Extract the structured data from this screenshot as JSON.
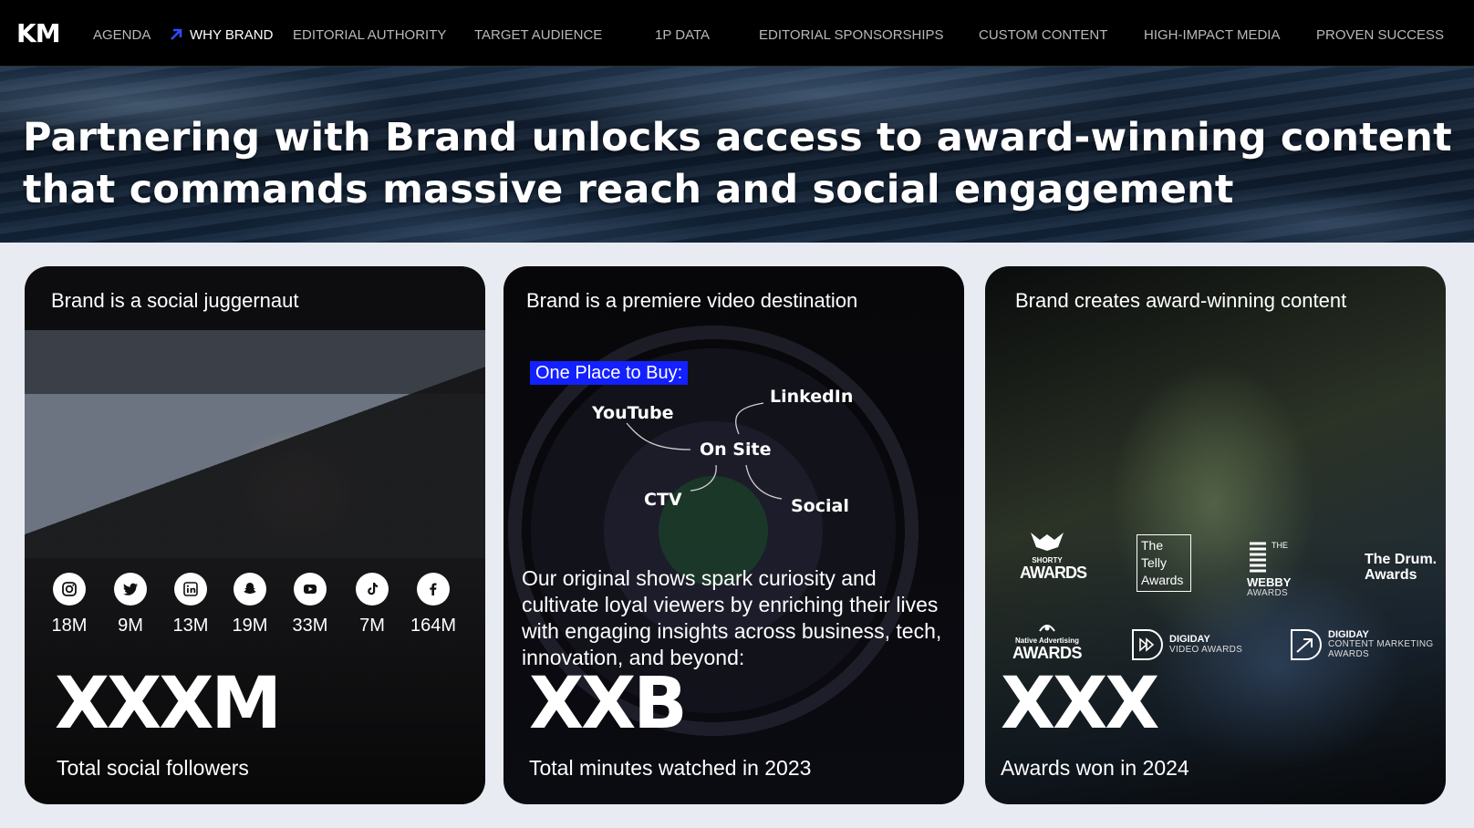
{
  "nav": {
    "logo": "KM",
    "items": [
      {
        "label": "AGENDA"
      },
      {
        "label": "WHY BRAND"
      },
      {
        "label": "EDITORIAL AUTHORITY"
      },
      {
        "label": "TARGET AUDIENCE"
      },
      {
        "label": "1P DATA"
      },
      {
        "label": "EDITORIAL SPONSORSHIPS"
      },
      {
        "label": "CUSTOM CONTENT"
      },
      {
        "label": "HIGH-IMPACT MEDIA"
      },
      {
        "label": "PROVEN SUCCESS"
      }
    ],
    "active_index": 1,
    "active_arrow_icon": "arrow-up-right-icon",
    "active_arrow_color": "#2f4bff"
  },
  "hero": {
    "title": "Partnering with Brand unlocks access to award-winning content that commands massive reach and social engagement"
  },
  "cards": {
    "social": {
      "title": "Brand is a social juggernaut",
      "platforms": [
        {
          "icon": "instagram-icon",
          "count": "18M"
        },
        {
          "icon": "twitter-icon",
          "count": "9M"
        },
        {
          "icon": "linkedin-icon",
          "count": "13M"
        },
        {
          "icon": "snapchat-icon",
          "count": "19M"
        },
        {
          "icon": "youtube-icon",
          "count": "33M"
        },
        {
          "icon": "tiktok-icon",
          "count": "7M"
        },
        {
          "icon": "facebook-icon",
          "count": "164M"
        }
      ],
      "stat": "XXXM",
      "caption": "Total social followers"
    },
    "video": {
      "title": "Brand is a premiere video destination",
      "badge": "One Place to Buy:",
      "badge_color": "#1320ff",
      "hub": "On Site",
      "channels": [
        "YouTube",
        "LinkedIn",
        "CTV",
        "Social"
      ],
      "body": "Our original shows spark curiosity and cultivate loyal viewers by enriching their lives with engaging insights across business, tech, innovation, and beyond:",
      "stat": "XXB",
      "caption": "Total minutes watched in 2023"
    },
    "awards": {
      "title": "Brand creates award-winning content",
      "logos": {
        "shorty_top": "SHORTY",
        "shorty_bottom": "AWARDS",
        "telly": [
          "The",
          "Telly",
          "Awards"
        ],
        "webby_the": "THE",
        "webby_main": "WEBBY",
        "webby_sub": "AWARDS",
        "drum": [
          "The Drum.",
          "Awards"
        ],
        "native_top": "Native Advertising",
        "native_bottom": "AWARDS",
        "digiday_video_top": "DIGIDAY",
        "digiday_video_bottom": "VIDEO AWARDS",
        "digiday_cm_top": "DIGIDAY",
        "digiday_cm_mid": "CONTENT MARKETING",
        "digiday_cm_bottom": "AWARDS"
      },
      "stat": "XXX",
      "caption": "Awards won in 2024"
    }
  }
}
